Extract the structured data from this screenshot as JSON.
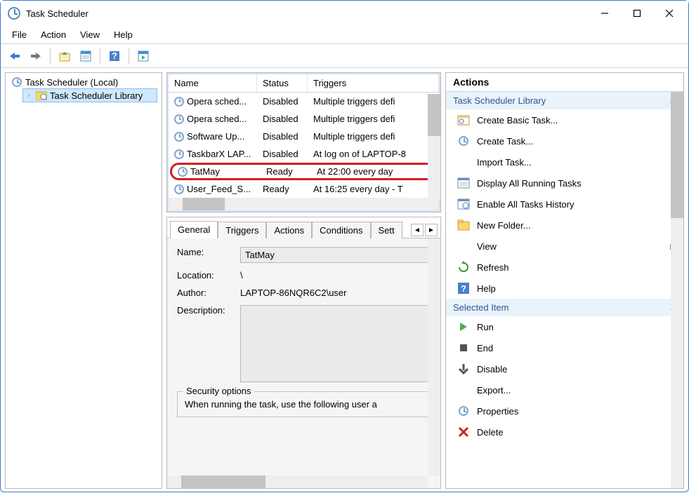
{
  "window": {
    "title": "Task Scheduler"
  },
  "menubar": {
    "file": "File",
    "action": "Action",
    "view": "View",
    "help": "Help"
  },
  "tree": {
    "root": "Task Scheduler (Local)",
    "library": "Task Scheduler Library"
  },
  "tasklist": {
    "headers": {
      "name": "Name",
      "status": "Status",
      "triggers": "Triggers"
    },
    "rows": [
      {
        "name": "Opera sched...",
        "status": "Disabled",
        "trigger": "Multiple triggers defi"
      },
      {
        "name": "Opera sched...",
        "status": "Disabled",
        "trigger": "Multiple triggers defi"
      },
      {
        "name": "Software Up...",
        "status": "Disabled",
        "trigger": "Multiple triggers defi"
      },
      {
        "name": "TaskbarX LAP...",
        "status": "Disabled",
        "trigger": "At log on of LAPTOP-8"
      },
      {
        "name": "TatMay",
        "status": "Ready",
        "trigger": "At 22:00 every day",
        "highlight": true
      },
      {
        "name": "User_Feed_S...",
        "status": "Ready",
        "trigger": "At 16:25 every day - T"
      }
    ]
  },
  "details": {
    "tabs": {
      "general": "General",
      "triggers": "Triggers",
      "actions": "Actions",
      "conditions": "Conditions",
      "settings": "Sett"
    },
    "fields": {
      "name_lbl": "Name:",
      "name_val": "TatMay",
      "location_lbl": "Location:",
      "location_val": "\\",
      "author_lbl": "Author:",
      "author_val": "LAPTOP-86NQR6C2\\user",
      "desc_lbl": "Description:",
      "desc_val": ""
    },
    "security_legend": "Security options",
    "security_text": "When running the task, use the following user a"
  },
  "actions": {
    "header": "Actions",
    "section1": "Task Scheduler Library",
    "items1": {
      "create_basic": "Create Basic Task...",
      "create_task": "Create Task...",
      "import": "Import Task...",
      "display_running": "Display All Running Tasks",
      "enable_history": "Enable All Tasks History",
      "new_folder": "New Folder...",
      "view": "View",
      "refresh": "Refresh",
      "help": "Help"
    },
    "section2": "Selected Item",
    "items2": {
      "run": "Run",
      "end": "End",
      "disable": "Disable",
      "export": "Export...",
      "properties": "Properties",
      "delete": "Delete"
    }
  }
}
